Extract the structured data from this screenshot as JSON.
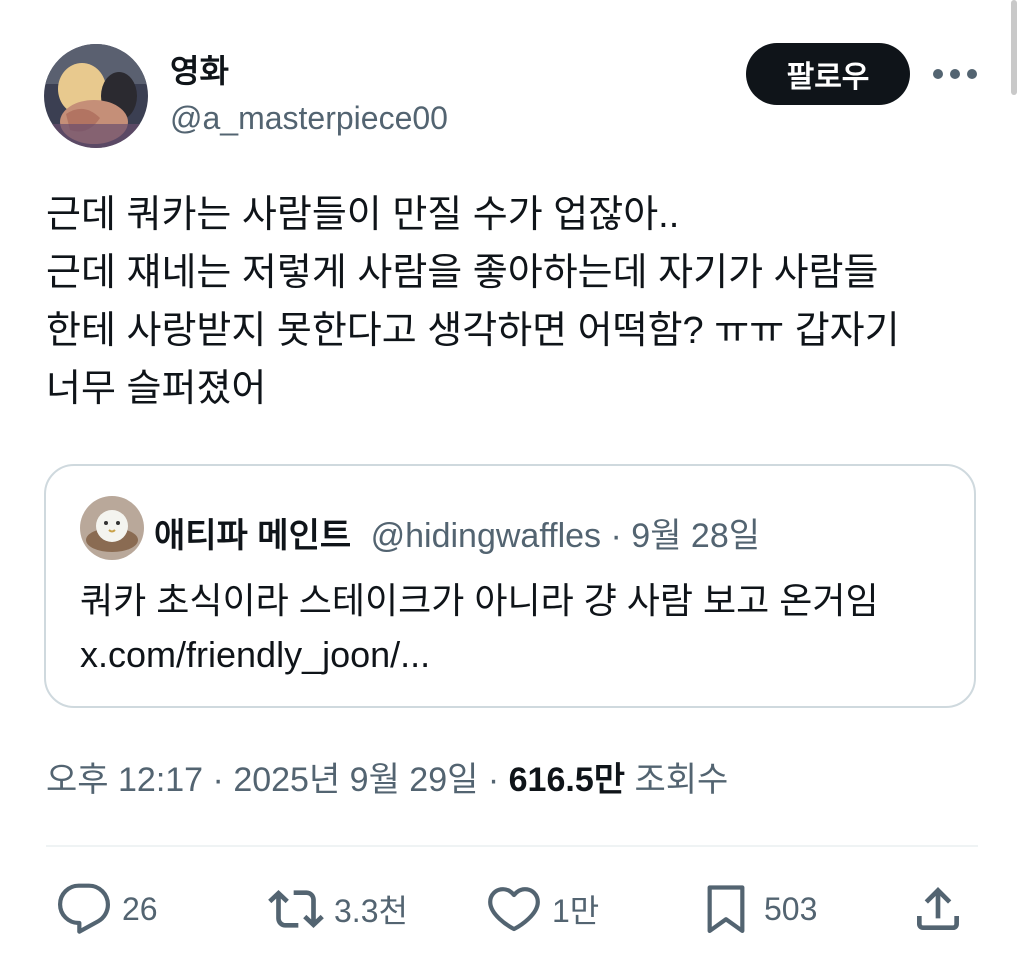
{
  "author": {
    "display_name": "영화",
    "handle": "@a_masterpiece00",
    "avatar_icon": "profile-photo"
  },
  "header": {
    "follow_label": "팔로우",
    "more_icon": "more-dots-icon"
  },
  "tweet": {
    "lines": [
      "근데 쿼카는 사람들이 만질 수가 업잖아..",
      "근데 쟤네는 저렇게 사람을 좋아하는데 자기가 사람들",
      "한테 사랑받지 못한다고 생각하면 어떡함? ㅠㅠ 갑자기",
      "너무 슬퍼졌어"
    ]
  },
  "quote": {
    "display_name": "애티파 메인트",
    "handle": "@hidingwaffles",
    "separator": " · ",
    "date": "9월 28일",
    "text": "쿼카 초식이라 스테이크가 아니라 걍 사람 보고 온거임",
    "link": "x.com/friendly_joon/..."
  },
  "meta": {
    "time": "오후 12:17",
    "sep": " · ",
    "date": "2025년 9월 29일",
    "views_count": "616.5만",
    "views_label": "조회수"
  },
  "actions": {
    "reply_count": "26",
    "retweet_count": "3.3천",
    "like_count": "1만",
    "bookmark_count": "503"
  },
  "colors": {
    "text_primary": "#0f1419",
    "text_secondary": "#536471",
    "border": "#cfd9de",
    "follow_bg": "#0f1419"
  }
}
